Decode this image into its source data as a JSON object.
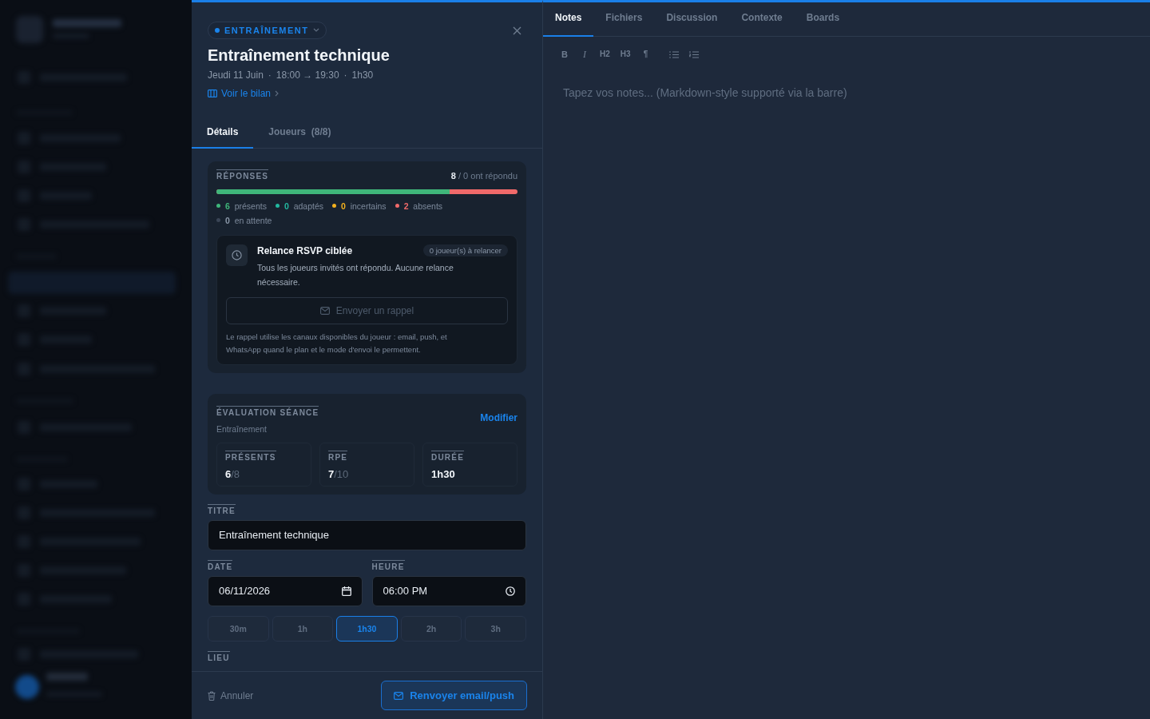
{
  "event": {
    "type_label": "ENTRAÎNEMENT",
    "title": "Entraînement technique",
    "meta": [
      "Jeudi 11 Juin",
      "18:00 → 19:30",
      "1h30"
    ],
    "separator": "·",
    "report_link": "Voir le bilan"
  },
  "tabs": [
    {
      "label": "Détails",
      "selected": true
    },
    {
      "label": "Joueurs  (8/8)",
      "selected": false
    }
  ],
  "responses": {
    "heading": "RÉPONSES",
    "total": "8",
    "summary": "/ 0 ont répondu",
    "bar": {
      "level": 0.775,
      "color": "#3fb67a"
    },
    "stats": [
      {
        "count": "6",
        "label": "présents",
        "color": "#3fb67a"
      },
      {
        "count": "0",
        "label": "adaptés",
        "color": "#22b8a0"
      },
      {
        "count": "0",
        "label": "incertains",
        "color": "#f2b01e"
      },
      {
        "count": "2",
        "label": "absents",
        "color": "#f06a6a"
      },
      {
        "count": "0",
        "label": "en attente",
        "color": "#3a4556"
      }
    ]
  },
  "reminder": {
    "title": "Relance RSVP ciblée",
    "badge": "0 joueur(s) à relancer",
    "text": "Tous les joueurs invités ont répondu. Aucune relance nécessaire.",
    "button": {
      "label": "Envoyer un rappel",
      "disabled": true
    },
    "note": "Le rappel utilise les canaux disponibles du joueur : email, push, et WhatsApp quand le plan et le mode d'envoi le permettent."
  },
  "evaluation": {
    "heading": "ÉVALUATION SÉANCE",
    "subtitle": "Entraînement",
    "edit_link": "Modifier",
    "metrics": [
      {
        "label": "PRÉSENTS",
        "value": "6",
        "suffix": "/8"
      },
      {
        "label": "RPE",
        "value": "7",
        "suffix": "/10"
      },
      {
        "label": "DURÉE",
        "value": "1h30"
      }
    ]
  },
  "form": {
    "title": {
      "label": "TITRE",
      "value": "Entraînement technique"
    },
    "date": {
      "label": "DATE",
      "value": "06/11/2026"
    },
    "time": {
      "label": "HEURE",
      "value": "06:00 PM"
    },
    "durations": [
      {
        "label": "30m",
        "selected": false
      },
      {
        "label": "1h",
        "selected": false
      },
      {
        "label": "1h30",
        "selected": true
      },
      {
        "label": "2h",
        "selected": false
      },
      {
        "label": "3h",
        "selected": false
      }
    ],
    "location_label": "LIEU"
  },
  "footer": {
    "cancel": "Annuler",
    "resend": "Renvoyer email/push"
  },
  "side_tabs": [
    {
      "label": "Notes",
      "selected": true
    },
    {
      "label": "Fichiers",
      "selected": false
    },
    {
      "label": "Discussion",
      "selected": false
    },
    {
      "label": "Contexte",
      "selected": false
    },
    {
      "label": "Boards",
      "selected": false
    }
  ],
  "toolbar": [
    {
      "kind": "bold",
      "text": "B"
    },
    {
      "kind": "italic",
      "text": "I"
    },
    {
      "kind": "text",
      "text": "H2"
    },
    {
      "kind": "text",
      "text": "H3"
    },
    {
      "kind": "text",
      "text": "¶"
    },
    {
      "kind": "bullet-list"
    },
    {
      "kind": "numbered-list"
    }
  ],
  "notes": {
    "placeholder": "Tapez vos notes... (Markdown-style supporté via la barre)"
  }
}
